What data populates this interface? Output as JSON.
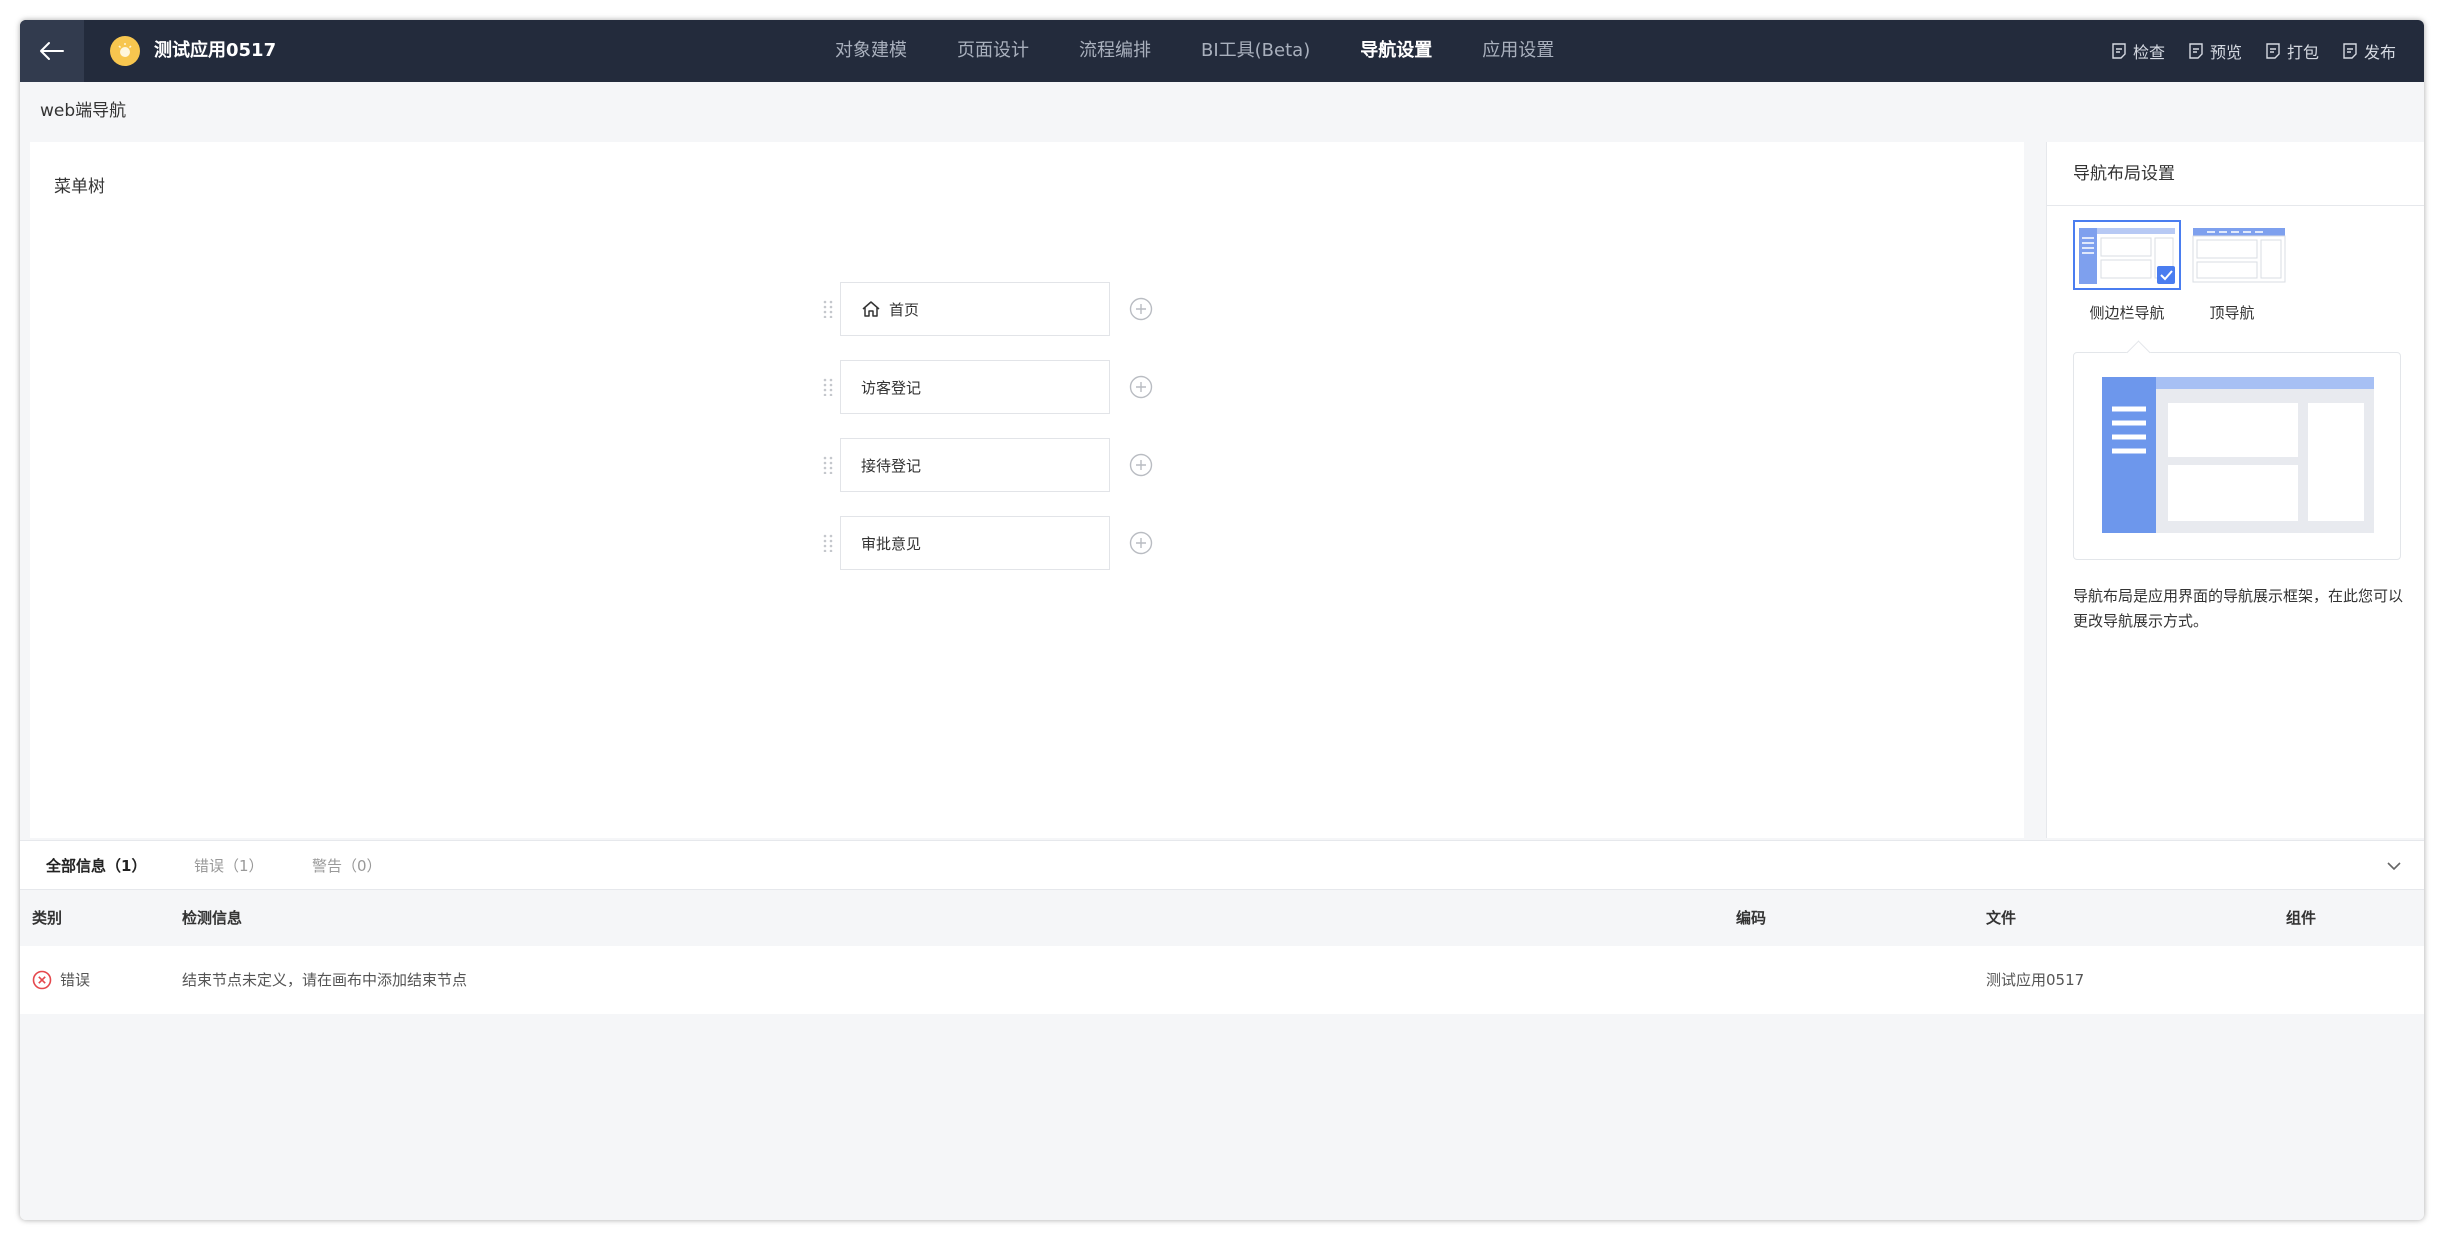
{
  "app": {
    "name": "测试应用0517"
  },
  "nav": {
    "tabs": [
      {
        "label": "对象建模"
      },
      {
        "label": "页面设计"
      },
      {
        "label": "流程编排"
      },
      {
        "label": "BI工具(Beta)"
      },
      {
        "label": "导航设置"
      },
      {
        "label": "应用设置"
      }
    ],
    "active_index": 4
  },
  "actions": {
    "check": "检查",
    "preview": "预览",
    "package": "打包",
    "publish": "发布"
  },
  "subheader": {
    "title": "web端导航"
  },
  "menu_tree": {
    "title": "菜单树",
    "items": [
      {
        "label": "首页",
        "icon": "home-icon"
      },
      {
        "label": "访客登记"
      },
      {
        "label": "接待登记"
      },
      {
        "label": "审批意见"
      }
    ]
  },
  "layout_settings": {
    "title": "导航布局设置",
    "options": [
      {
        "label": "侧边栏导航",
        "selected": true
      },
      {
        "label": "顶导航",
        "selected": false
      }
    ],
    "description": "导航布局是应用界面的导航展示框架，在此您可以更改导航展示方式。"
  },
  "console": {
    "tabs": [
      {
        "label": "全部信息（1）"
      },
      {
        "label": "错误（1）"
      },
      {
        "label": "警告（0）"
      }
    ],
    "columns": {
      "type": "类别",
      "message": "检测信息",
      "code": "编码",
      "file": "文件",
      "component": "组件"
    },
    "rows": [
      {
        "type": "错误",
        "message": "结束节点未定义，请在画布中添加结束节点",
        "code": "",
        "file": "测试应用0517",
        "component": ""
      }
    ]
  },
  "colors": {
    "topbar": "#232b3c",
    "accent": "#4a7df0",
    "error": "#e5484d"
  }
}
